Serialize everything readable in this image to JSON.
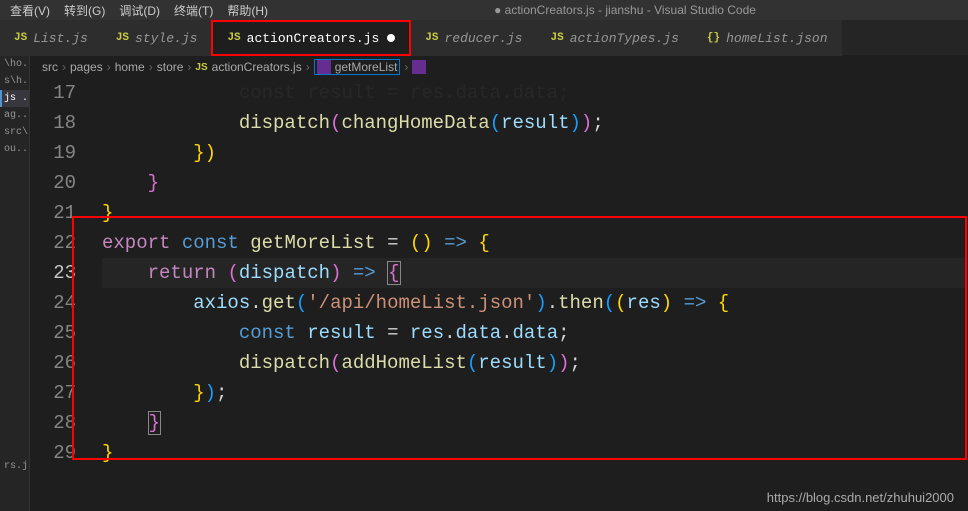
{
  "menubar": {
    "items": [
      "查看(V)",
      "转到(G)",
      "调试(D)",
      "终端(T)",
      "帮助(H)"
    ],
    "title_dot": "●",
    "title_file": "actionCreators.js",
    "title_project": "jianshu",
    "title_app": "Visual Studio Code"
  },
  "tabs": [
    {
      "icon": "JS",
      "label": "List.js",
      "active": false
    },
    {
      "icon": "JS",
      "label": "style.js",
      "active": false
    },
    {
      "icon": "JS",
      "label": "actionCreators.js",
      "active": true,
      "dirty": true,
      "highlighted": true
    },
    {
      "icon": "JS",
      "label": "reducer.js",
      "active": false
    },
    {
      "icon": "JS",
      "label": "actionTypes.js",
      "active": false
    },
    {
      "icon": "{}",
      "label": "homeList.json",
      "active": false
    }
  ],
  "sidebar": {
    "items": [
      {
        "label": "\\ho..."
      },
      {
        "label": "s\\h..."
      },
      {
        "label": "js ...",
        "active": true
      },
      {
        "label": "ag..."
      },
      {
        "label": "src\\..."
      },
      {
        "label": "ou..."
      }
    ],
    "bottom": [
      {
        "label": "rs.js"
      }
    ]
  },
  "breadcrumb": {
    "parts": [
      "src",
      "pages",
      "home",
      "store"
    ],
    "file_icon": "JS",
    "file": "actionCreators.js",
    "sym1": "getMoreList",
    "sym2": "<function>"
  },
  "code": {
    "lines": [
      {
        "n": 17,
        "indent": "            ",
        "raw": "const result = res.data.data;",
        "cut": true
      },
      {
        "n": 18,
        "indent": "            ",
        "tokens": [
          [
            "fn",
            "dispatch"
          ],
          [
            "br2",
            "("
          ],
          [
            "fn",
            "changHomeData"
          ],
          [
            "br3",
            "("
          ],
          [
            "var",
            "result"
          ],
          [
            "br3",
            ")"
          ],
          [
            "br2",
            ")"
          ],
          [
            "p",
            ";"
          ]
        ]
      },
      {
        "n": 19,
        "indent": "        ",
        "tokens": [
          [
            "br1",
            "}"
          ],
          [
            "br1",
            ")"
          ]
        ]
      },
      {
        "n": 20,
        "indent": "    ",
        "tokens": [
          [
            "br2",
            "}"
          ]
        ]
      },
      {
        "n": 21,
        "indent": "",
        "tokens": [
          [
            "br1",
            "}"
          ]
        ]
      },
      {
        "n": 22,
        "indent": "",
        "tokens": [
          [
            "kw",
            "export"
          ],
          [
            "p",
            " "
          ],
          [
            "kw2",
            "const"
          ],
          [
            "p",
            " "
          ],
          [
            "fn",
            "getMoreList"
          ],
          [
            "p",
            " = "
          ],
          [
            "br1",
            "("
          ],
          [
            "br1",
            ")"
          ],
          [
            "p",
            " "
          ],
          [
            "kw2",
            "=>"
          ],
          [
            "p",
            " "
          ],
          [
            "br1",
            "{"
          ]
        ]
      },
      {
        "n": 23,
        "indent": "    ",
        "active": true,
        "tokens": [
          [
            "kw",
            "return"
          ],
          [
            "p",
            " "
          ],
          [
            "br2",
            "("
          ],
          [
            "var",
            "dispatch"
          ],
          [
            "br2",
            ")"
          ],
          [
            "p",
            " "
          ],
          [
            "kw2",
            "=>"
          ],
          [
            "p",
            " "
          ],
          [
            "br2",
            "{",
            "hl"
          ]
        ]
      },
      {
        "n": 24,
        "indent": "        ",
        "tokens": [
          [
            "var",
            "axios"
          ],
          [
            "p",
            "."
          ],
          [
            "fn",
            "get"
          ],
          [
            "br3",
            "("
          ],
          [
            "str",
            "'/api/homeList.json'"
          ],
          [
            "br3",
            ")"
          ],
          [
            "p",
            "."
          ],
          [
            "fn",
            "then"
          ],
          [
            "br3",
            "("
          ],
          [
            "br1",
            "("
          ],
          [
            "var",
            "res"
          ],
          [
            "br1",
            ")"
          ],
          [
            "p",
            " "
          ],
          [
            "kw2",
            "=>"
          ],
          [
            "p",
            " "
          ],
          [
            "br1",
            "{"
          ]
        ]
      },
      {
        "n": 25,
        "indent": "            ",
        "tokens": [
          [
            "kw2",
            "const"
          ],
          [
            "p",
            " "
          ],
          [
            "var",
            "result"
          ],
          [
            "p",
            " = "
          ],
          [
            "var",
            "res"
          ],
          [
            "p",
            "."
          ],
          [
            "var",
            "data"
          ],
          [
            "p",
            "."
          ],
          [
            "var",
            "data"
          ],
          [
            "p",
            ";"
          ]
        ]
      },
      {
        "n": 26,
        "indent": "            ",
        "tokens": [
          [
            "fn",
            "dispatch"
          ],
          [
            "br2",
            "("
          ],
          [
            "fn",
            "addHomeList"
          ],
          [
            "br3",
            "("
          ],
          [
            "var",
            "result"
          ],
          [
            "br3",
            ")"
          ],
          [
            "br2",
            ")"
          ],
          [
            "p",
            ";"
          ]
        ]
      },
      {
        "n": 27,
        "indent": "        ",
        "tokens": [
          [
            "br1",
            "}"
          ],
          [
            "br3",
            ")"
          ],
          [
            "p",
            ";"
          ]
        ]
      },
      {
        "n": 28,
        "indent": "    ",
        "tokens": [
          [
            "br2",
            "}",
            "hl"
          ]
        ]
      },
      {
        "n": 29,
        "indent": "",
        "tokens": [
          [
            "br1",
            "}"
          ]
        ]
      }
    ]
  },
  "watermark": "https://blog.csdn.net/zhuhui2000"
}
